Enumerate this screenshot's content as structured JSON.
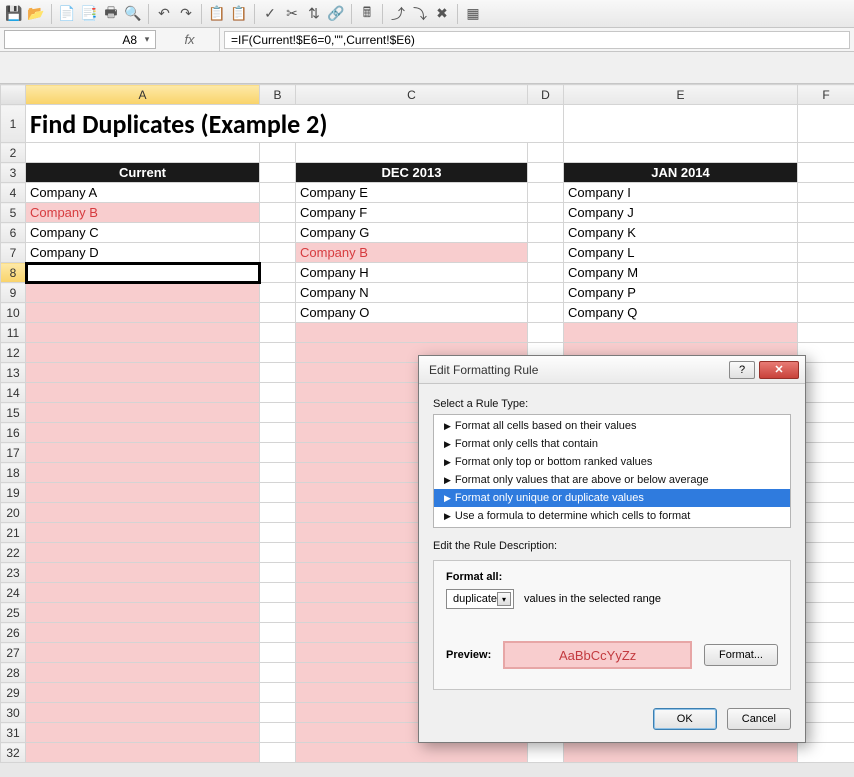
{
  "namebox": "A8",
  "fx_label": "fx",
  "formula": "=IF(Current!$E6=0,\"\",Current!$E6)",
  "columns": [
    "A",
    "B",
    "C",
    "D",
    "E",
    "F"
  ],
  "rows": [
    "1",
    "2",
    "3",
    "4",
    "5",
    "6",
    "7",
    "8",
    "9",
    "10",
    "11",
    "12",
    "13",
    "14",
    "15",
    "16",
    "17",
    "18",
    "19",
    "20",
    "21",
    "22",
    "23",
    "24",
    "25",
    "26",
    "27",
    "28",
    "29",
    "30",
    "31",
    "32"
  ],
  "title": "Find Duplicates (Example 2)",
  "headers": {
    "A": "Current",
    "C": "DEC 2013",
    "E": "JAN 2014"
  },
  "cells": {
    "A4": "Company A",
    "A5": "Company B",
    "A6": "Company C",
    "A7": "Company D",
    "C4": "Company E",
    "C5": "Company F",
    "C6": "Company G",
    "C7": "Company B",
    "C8": "Company H",
    "C9": "Company N",
    "C10": "Company O",
    "E4": "Company I",
    "E5": "Company J",
    "E6": "Company K",
    "E7": "Company L",
    "E8": "Company M",
    "E9": "Company P",
    "E10": "Company Q"
  },
  "dialog": {
    "title": "Edit Formatting Rule",
    "select_label": "Select a Rule Type:",
    "rules": [
      "Format all cells based on their values",
      "Format only cells that contain",
      "Format only top or bottom ranked values",
      "Format only values that are above or below average",
      "Format only unique or duplicate values",
      "Use a formula to determine which cells to format"
    ],
    "selected_rule_index": 4,
    "edit_label": "Edit the Rule Description:",
    "format_all_label": "Format all:",
    "dup_select": "duplicate",
    "dup_suffix": "values in the selected range",
    "preview_label": "Preview:",
    "preview_text": "AaBbCcYyZz",
    "format_btn": "Format...",
    "ok": "OK",
    "cancel": "Cancel",
    "help": "?",
    "close": "✕"
  }
}
